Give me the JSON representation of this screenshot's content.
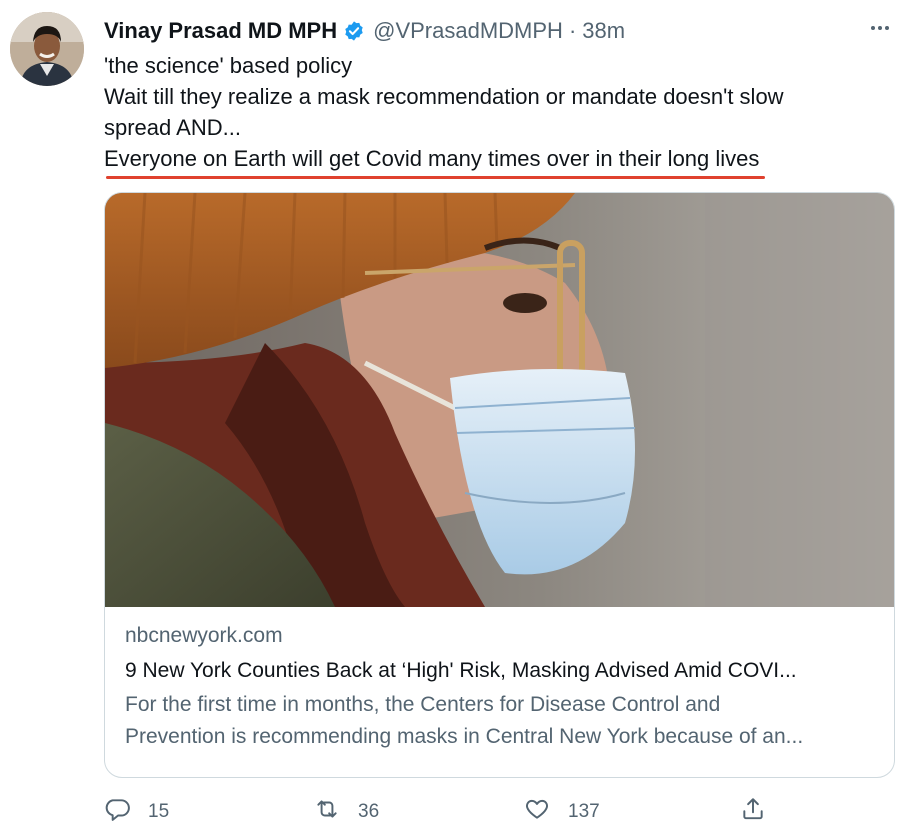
{
  "tweet": {
    "author_name": "Vinay Prasad MD MPH",
    "handle": "@VPrasadMDMPH",
    "separator": "·",
    "time": "38m",
    "lines": [
      "'the science' based policy",
      "Wait till they realize a mask recommendation or mandate doesn't slow",
      "spread AND...",
      "Everyone on Earth will get Covid many times over in their long lives"
    ],
    "icons": {
      "verified": "verified-badge-icon",
      "more": "more-horizontal-icon"
    },
    "colors": {
      "verified": "#1d9bf0",
      "underline": "#e0412e",
      "secondary_text": "#536471"
    }
  },
  "link_card": {
    "domain": "nbcnewyork.com",
    "headline": "9 New York Counties Back at ‘High' Risk, Masking Advised Amid COVI...",
    "description_lines": [
      "For the first time in months, the Centers for Disease Control and",
      "Prevention is recommending masks in Central New York because of an..."
    ]
  },
  "actions": {
    "reply_count": "15",
    "retweet_count": "36",
    "like_count": "137",
    "icons": [
      "reply-icon",
      "retweet-icon",
      "like-icon",
      "share-icon"
    ]
  }
}
